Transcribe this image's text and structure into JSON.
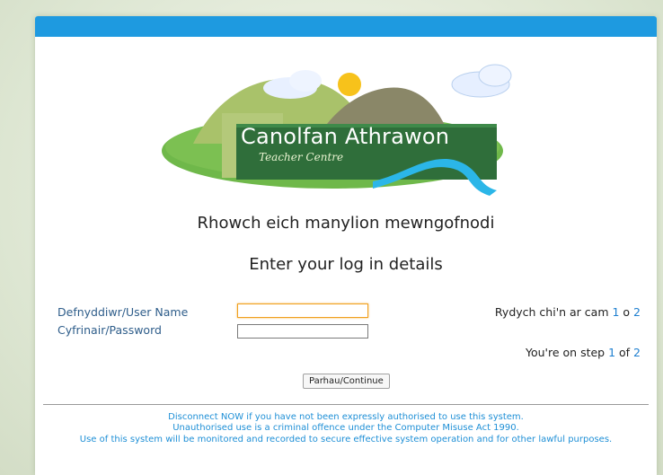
{
  "logo": {
    "title": "Canolfan Athrawon",
    "subtitle": "Teacher Centre",
    "colors": {
      "hill_light": "#a9c26a",
      "hill_dark": "#8a8768",
      "lawn": "#5aab3c",
      "banner": "#2f6e3a",
      "river": "#2bb6e8",
      "sun": "#f7c21b"
    }
  },
  "heading": {
    "welsh": "Rhowch eich manylion mewngofnodi",
    "english": "Enter your log in details"
  },
  "form": {
    "username_label": "Defnyddiwr/User Name",
    "password_label": "Cyfrinair/Password",
    "username_value": "",
    "password_value": "",
    "submit_label": "Parhau/Continue"
  },
  "step": {
    "welsh_prefix": "Rydych chi'n ar cam ",
    "welsh_join": " o ",
    "english_prefix": "You're on step ",
    "english_join": " of ",
    "current": "1",
    "total": "2"
  },
  "notice": {
    "line1": "Disconnect NOW if you have not been expressly authorised to use this system.",
    "line2": "Unauthorised use is a criminal offence under the Computer Misuse Act 1990.",
    "line3": "Use of this system will be monitored and recorded to secure effective system operation and for other lawful purposes."
  },
  "colors": {
    "topbar": "#1e9ae0",
    "label": "#2e5d8a",
    "link": "#1e7fd0",
    "notice": "#1e8fd6"
  }
}
